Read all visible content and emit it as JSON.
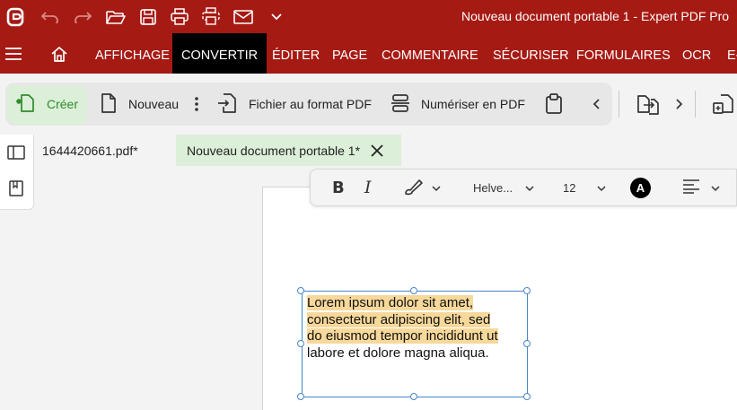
{
  "window": {
    "title": "Nouveau document portable 1  -  Expert PDF Pro"
  },
  "colors": {
    "brand": "#a61a14",
    "active_tab": "#000000",
    "create_highlight": "#dcefd8",
    "selection_highlight": "#f6d89a",
    "selection_border": "#4a86c5"
  },
  "quick_access": [
    {
      "name": "app-logo-icon"
    },
    {
      "name": "undo-icon"
    },
    {
      "name": "redo-icon"
    },
    {
      "name": "open-folder-icon"
    },
    {
      "name": "save-icon"
    },
    {
      "name": "print-icon"
    },
    {
      "name": "scan-print-icon"
    },
    {
      "name": "email-icon"
    },
    {
      "name": "chevron-down-icon"
    }
  ],
  "tabs": [
    {
      "label": "AFFICHAGE"
    },
    {
      "label": "CONVERTIR",
      "active": true
    },
    {
      "label": "ÉDITER"
    },
    {
      "label": "PAGE"
    },
    {
      "label": "COMMENTAIRE"
    },
    {
      "label": "SÉCURISER"
    },
    {
      "label": "FORMULAIRES"
    },
    {
      "label": "OCR"
    },
    {
      "label": "E-"
    }
  ],
  "ribbon": {
    "create_label": "Créer",
    "new_label": "Nouveau",
    "from_file_label": "Fichier au format PDF",
    "scan_label": "Numériser en PDF"
  },
  "documents": [
    {
      "label": "1644420661.pdf*"
    },
    {
      "label": "Nouveau document portable 1*",
      "active": true
    }
  ],
  "format_toolbar": {
    "font": "Helve...",
    "size": "12",
    "color_letter": "A"
  },
  "text_box": {
    "lines": [
      {
        "text": "Lorem ipsum dolor sit amet,",
        "selected": true
      },
      {
        "text": "consectetur adipiscing elit, sed",
        "selected": true
      },
      {
        "text": "do eiusmod tempor incididunt ut",
        "selected": true
      },
      {
        "text": "labore et dolore magna aliqua.",
        "selected": false
      }
    ]
  }
}
